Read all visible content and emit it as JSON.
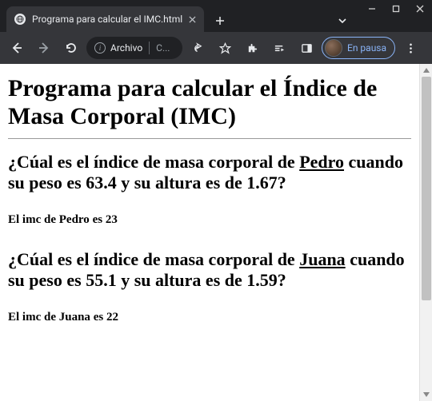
{
  "window": {
    "tab_title": "Programa para calcular el IMC.html"
  },
  "toolbar": {
    "url_scheme": "Archivo",
    "url_path": "C...",
    "profile_status": "En pausa"
  },
  "page": {
    "heading": "Programa para calcular el Índice de Masa Corporal (IMC)",
    "entries": [
      {
        "q_prefix": "¿Cúal es el índice de masa corporal de ",
        "name": "Pedro",
        "q_mid": " cuando su peso es ",
        "weight": "63.4",
        "q_mid2": " y su altura es de ",
        "height": "1.67",
        "q_suffix": "?",
        "result_prefix": "El imc de ",
        "result_name": "Pedro",
        "result_mid": " es ",
        "imc": "23"
      },
      {
        "q_prefix": "¿Cúal es el índice de masa corporal de ",
        "name": "Juana",
        "q_mid": " cuando su peso es ",
        "weight": "55.1",
        "q_mid2": " y su altura es de ",
        "height": "1.59",
        "q_suffix": "?",
        "result_prefix": "El imc de ",
        "result_name": "Juana",
        "result_mid": " es ",
        "imc": "22"
      }
    ]
  }
}
